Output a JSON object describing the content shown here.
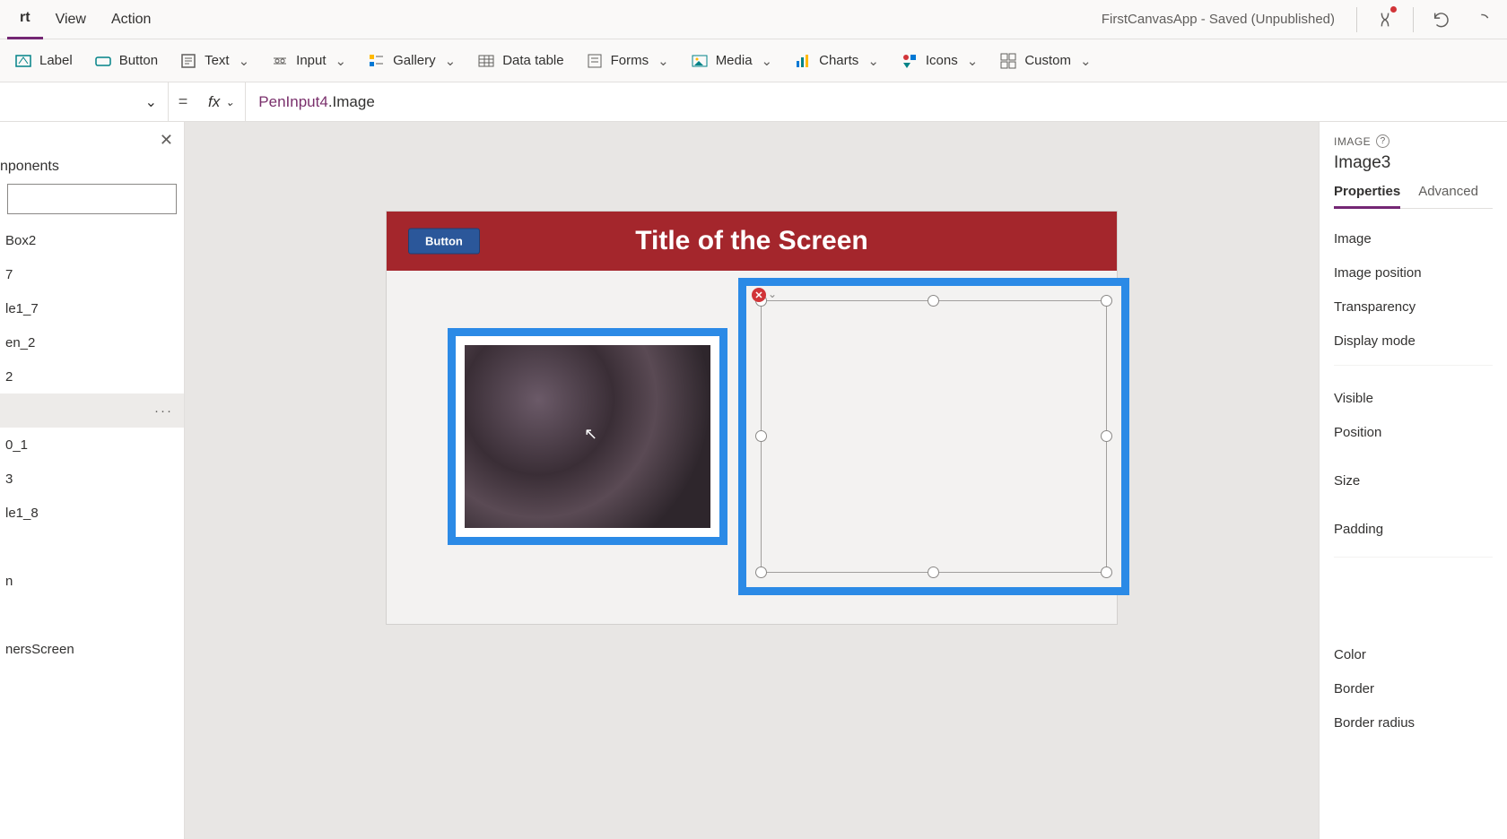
{
  "menubar": {
    "tabs": [
      "rt",
      "View",
      "Action"
    ],
    "active_index": 0,
    "app_status": "FirstCanvasApp - Saved (Unpublished)"
  },
  "ribbon": {
    "items": [
      {
        "label": "Label",
        "has_chev": false
      },
      {
        "label": "Button",
        "has_chev": false
      },
      {
        "label": "Text",
        "has_chev": true
      },
      {
        "label": "Input",
        "has_chev": true
      },
      {
        "label": "Gallery",
        "has_chev": true
      },
      {
        "label": "Data table",
        "has_chev": false
      },
      {
        "label": "Forms",
        "has_chev": true
      },
      {
        "label": "Media",
        "has_chev": true
      },
      {
        "label": "Charts",
        "has_chev": true
      },
      {
        "label": "Icons",
        "has_chev": true
      },
      {
        "label": "Custom",
        "has_chev": true
      }
    ]
  },
  "formula": {
    "eq": "=",
    "fx": "fx",
    "ref": "PenInput4",
    "prop": ".Image"
  },
  "tree": {
    "header_tab": "nponents",
    "nodes": [
      {
        "label": "Box2"
      },
      {
        "label": "7"
      },
      {
        "label": "le1_7"
      },
      {
        "label": "en_2"
      },
      {
        "label": "2"
      },
      {
        "label": "",
        "selected": true,
        "more": true
      },
      {
        "label": "0_1"
      },
      {
        "label": "3"
      },
      {
        "label": "le1_8"
      },
      {
        "label": ""
      },
      {
        "label": "n"
      },
      {
        "label": ""
      },
      {
        "label": "nersScreen"
      }
    ]
  },
  "canvas": {
    "header_title": "Title of the Screen",
    "button_label": "Button"
  },
  "props_panel": {
    "type_label": "IMAGE",
    "object_name": "Image3",
    "tabs": [
      "Properties",
      "Advanced"
    ],
    "active_tab": 0,
    "rows": [
      "Image",
      "Image position",
      "Transparency",
      "Display mode",
      "__spacer__",
      "Visible",
      "Position",
      "__gap__",
      "Size",
      "__gap__",
      "Padding",
      "__bigspacer__",
      "Color",
      "Border",
      "Border radius"
    ]
  }
}
